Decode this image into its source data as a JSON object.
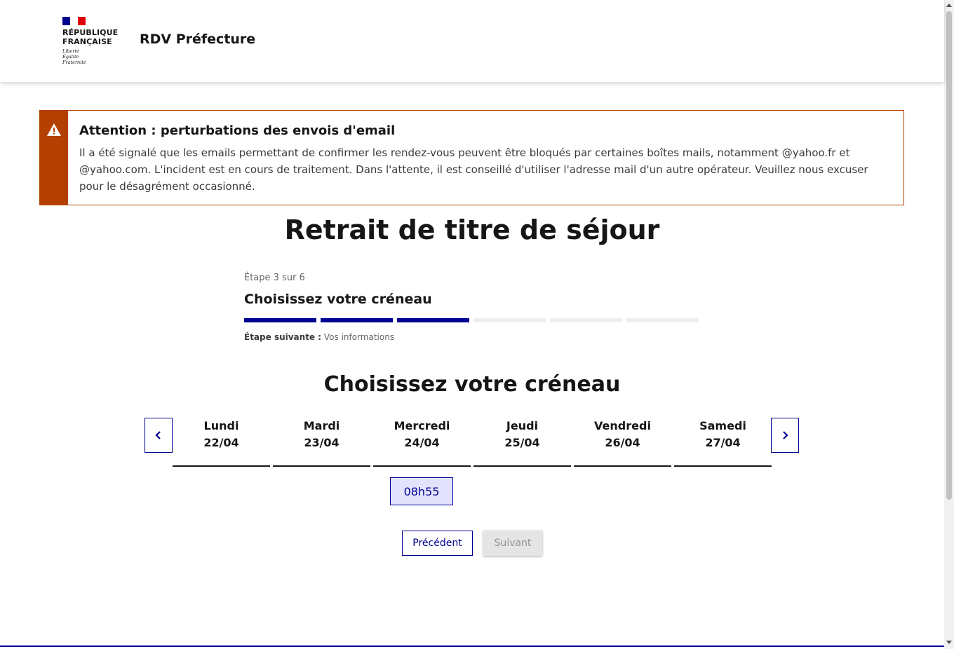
{
  "header": {
    "logo_title_line1": "République",
    "logo_title_line2": "Française",
    "motto": [
      "Liberté",
      "Égalité",
      "Fraternité"
    ],
    "service_name": "RDV Préfecture"
  },
  "alert": {
    "title": "Attention : perturbations des envois d'email",
    "text": "Il a été signalé que les emails permettant de confirmer les rendez-vous peuvent être bloqués par certaines boîtes mails, notamment @yahoo.fr et @yahoo.com. L'incident est en cours de traitement. Dans l'attente, il est conseillé d'utiliser l'adresse mail d'un autre opérateur. Veuillez nous excuser pour le désagrément occasionné.",
    "icon": "warning-icon",
    "accent_color": "#b34000"
  },
  "page_title": "Retrait de titre de séjour",
  "stepper": {
    "step_count": "Étape 3 sur 6",
    "current_step": 3,
    "total_steps": 6,
    "title": "Choisissez votre créneau",
    "next_label": "Étape suivante :",
    "next_value": "Vos informations",
    "active_color": "#000091"
  },
  "slots": {
    "section_title": "Choisissez votre créneau",
    "prev_icon": "chevron-left-icon",
    "next_icon": "chevron-right-icon",
    "days": [
      {
        "name": "Lundi",
        "date": "22/04"
      },
      {
        "name": "Mardi",
        "date": "23/04"
      },
      {
        "name": "Mercredi",
        "date": "24/04"
      },
      {
        "name": "Jeudi",
        "date": "25/04"
      },
      {
        "name": "Vendredi",
        "date": "26/04"
      },
      {
        "name": "Samedi",
        "date": "27/04"
      }
    ],
    "available_slot": "08h55"
  },
  "buttons": {
    "previous": "Précédent",
    "next": "Suivant"
  }
}
